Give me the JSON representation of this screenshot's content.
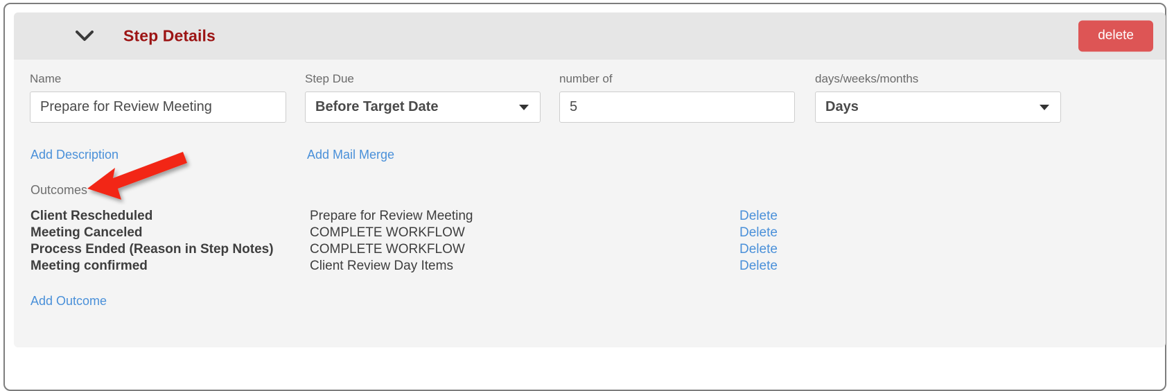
{
  "panel": {
    "title": "Step Details",
    "collapse_icon": "chevron-down-icon",
    "delete_button": "delete"
  },
  "fields": [
    {
      "key": "name",
      "label": "Name",
      "value": "Prepare for Review Meeting",
      "type": "text"
    },
    {
      "key": "due",
      "label": "Step Due",
      "value": "Before Target Date",
      "type": "select"
    },
    {
      "key": "count",
      "label": "number of",
      "value": "5",
      "type": "text"
    },
    {
      "key": "unit",
      "label": "days/weeks/months",
      "value": "Days",
      "type": "select"
    }
  ],
  "links": {
    "add_description": "Add Description",
    "add_mail_merge": "Add Mail Merge",
    "add_outcome": "Add Outcome"
  },
  "outcomes": {
    "label": "Outcomes",
    "delete_label": "Delete",
    "rows": [
      {
        "name": "Client Rescheduled",
        "target": "Prepare for Review Meeting",
        "action": "Delete"
      },
      {
        "name": "Meeting Canceled",
        "target": "COMPLETE WORKFLOW",
        "action": "Delete"
      },
      {
        "name": "Process Ended (Reason in Step Notes)",
        "target": "COMPLETE WORKFLOW",
        "action": "Delete"
      },
      {
        "name": "Meeting confirmed",
        "target": "Client Review Day Items",
        "action": "Delete"
      }
    ]
  },
  "annotation": {
    "type": "arrow",
    "color": "#f22613",
    "points_to": "Outcomes"
  },
  "colors": {
    "title": "#9c1414",
    "delete_button_bg": "#dd5555",
    "link": "#4a90d9",
    "header_bg": "#e6e6e6",
    "body_bg": "#f4f4f4",
    "frame_border": "#7d7d7d"
  }
}
